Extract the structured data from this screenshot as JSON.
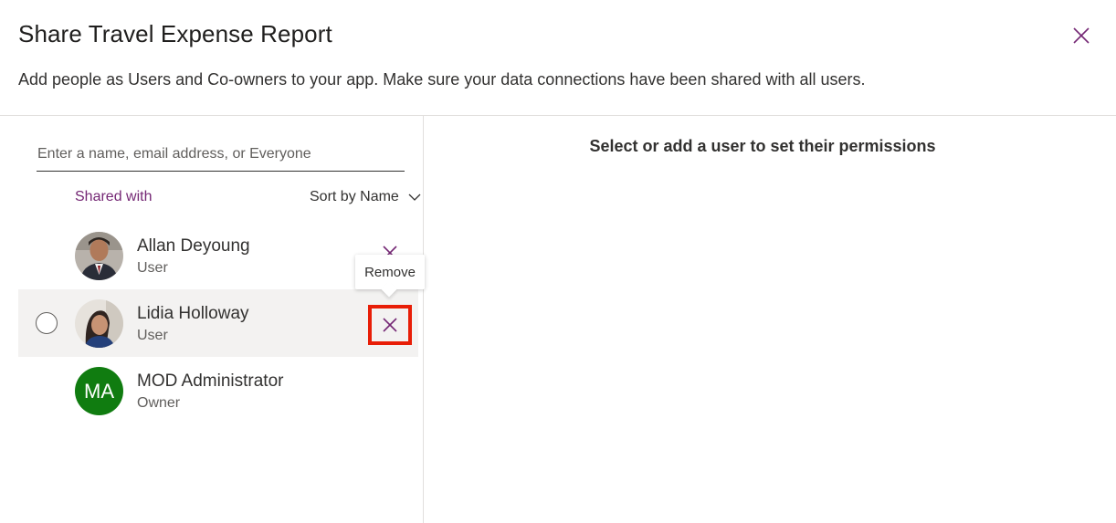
{
  "dialog": {
    "title": "Share Travel Expense Report",
    "subtitle": "Add people as Users and Co-owners to your app. Make sure your data connections have been shared with all users.",
    "close_icon": "close-icon"
  },
  "search": {
    "placeholder": "Enter a name, email address, or Everyone",
    "value": ""
  },
  "list": {
    "shared_with_label": "Shared with",
    "sort_label": "Sort by Name",
    "accent_color": "#742774",
    "users": [
      {
        "name": "Allan Deyoung",
        "role": "User",
        "avatar": "photo"
      },
      {
        "name": "Lidia Holloway",
        "role": "User",
        "avatar": "photo",
        "selected": true
      },
      {
        "name": "MOD Administrator",
        "role": "Owner",
        "avatar": "initials",
        "initials": "MA",
        "avatar_color": "#107c10"
      }
    ]
  },
  "tooltip": {
    "text": "Remove"
  },
  "right_panel": {
    "message": "Select or add a user to set their permissions"
  }
}
